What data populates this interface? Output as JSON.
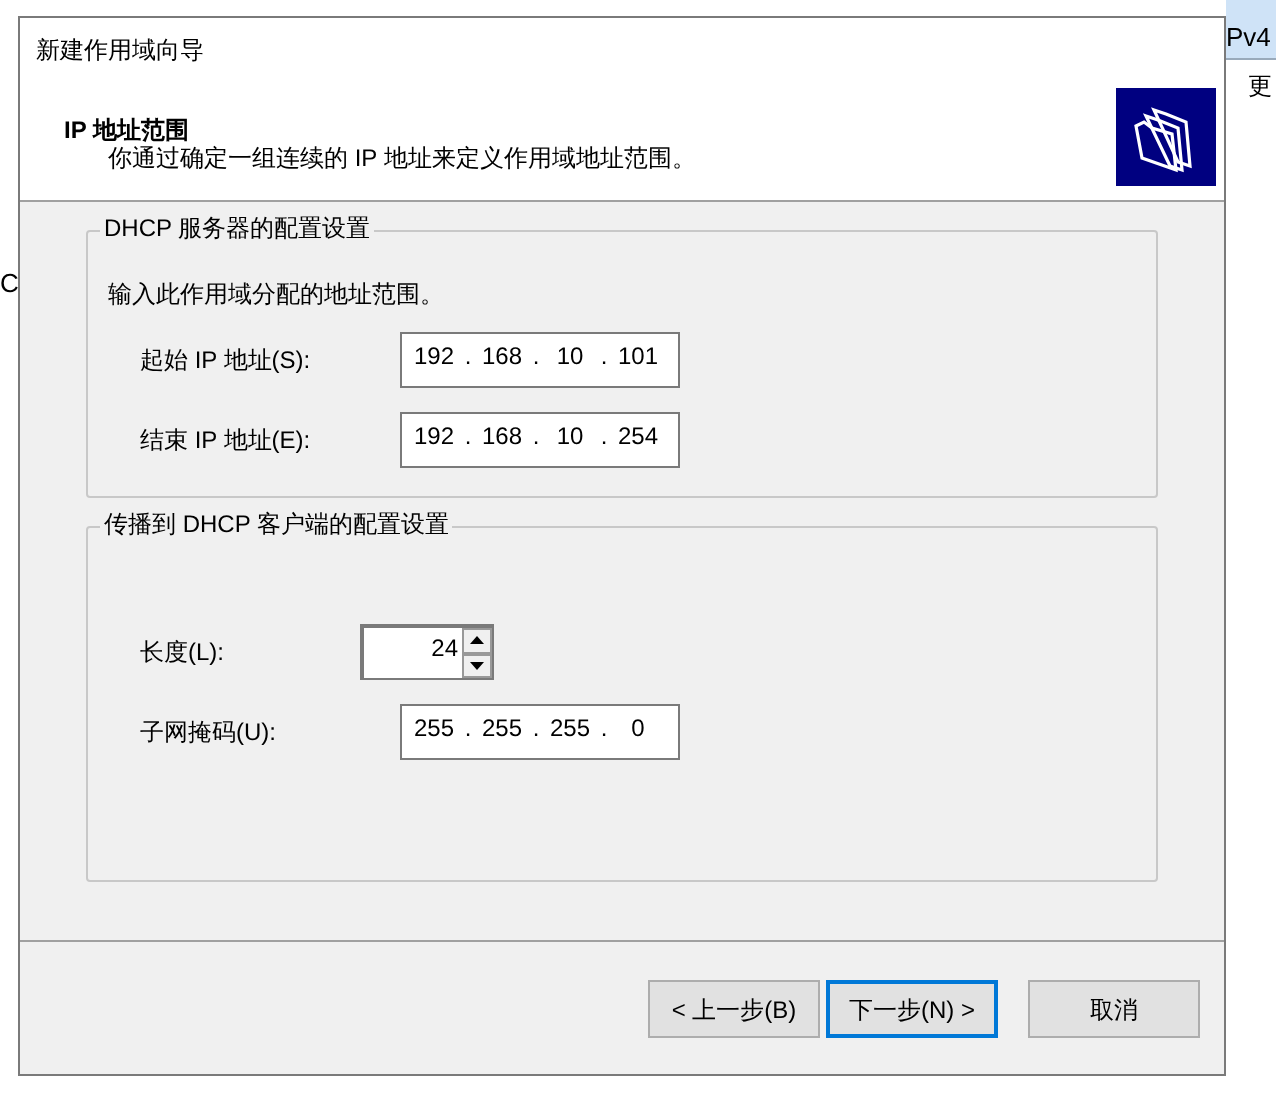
{
  "background": {
    "left_text": "C",
    "right_header": "Pv4",
    "right_text": "更"
  },
  "window": {
    "title": "新建作用域向导"
  },
  "header": {
    "title": "IP 地址范围",
    "subtitle": "你通过确定一组连续的 IP 地址来定义作用域地址范围。"
  },
  "groups": [
    {
      "title": "DHCP 服务器的配置设置",
      "note": "输入此作用域分配的地址范围。",
      "fields": [
        {
          "kind": "ip",
          "label": "起始 IP 地址(S):",
          "separator": ".",
          "octets": [
            "192",
            "168",
            "10",
            "101"
          ]
        },
        {
          "kind": "ip",
          "label": "结束 IP 地址(E):",
          "separator": ".",
          "octets": [
            "192",
            "168",
            "10",
            "254"
          ]
        }
      ]
    },
    {
      "title": "传播到 DHCP 客户端的配置设置",
      "fields": [
        {
          "kind": "spin",
          "label": "长度(L):",
          "value": "24"
        },
        {
          "kind": "ip",
          "label": "子网掩码(U):",
          "separator": ".",
          "octets": [
            "255",
            "255",
            "255",
            "0"
          ]
        }
      ]
    }
  ],
  "buttons": [
    {
      "label": "< 上一步(B)",
      "selected": false
    },
    {
      "label": "下一步(N) >",
      "selected": true
    },
    {
      "label": "取消",
      "selected": false
    }
  ]
}
